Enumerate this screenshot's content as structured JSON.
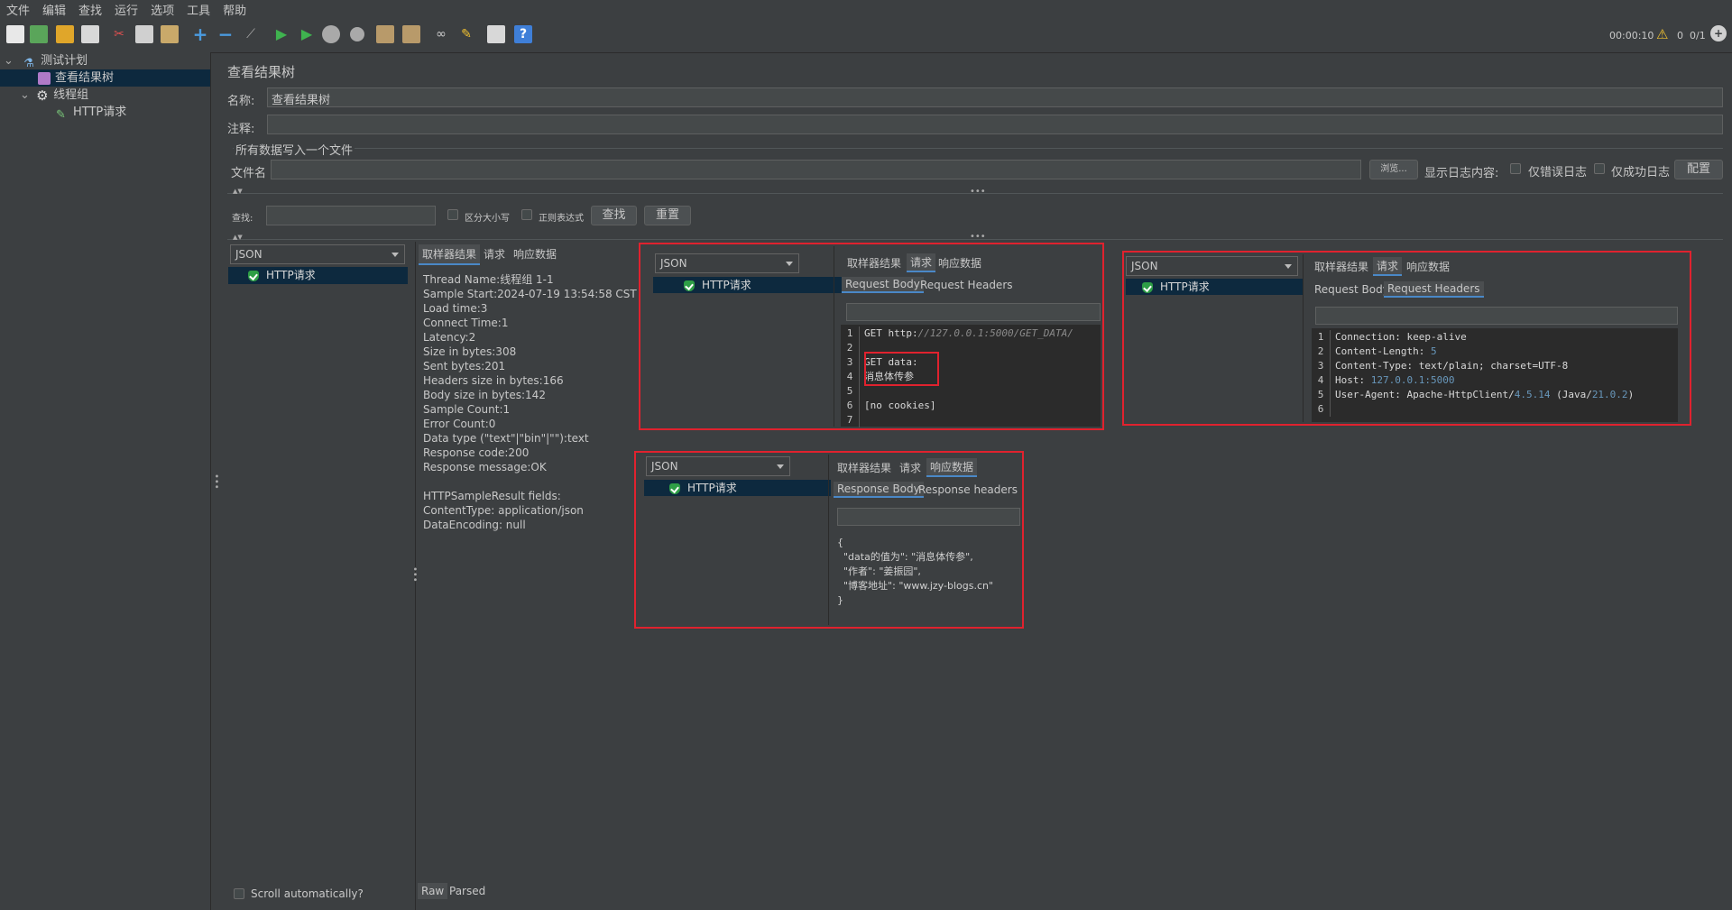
{
  "menu": [
    "文件",
    "编辑",
    "查找",
    "运行",
    "选项",
    "工具",
    "帮助"
  ],
  "toolbar": {
    "timer": "00:00:10",
    "warnings": "0",
    "threads": "0/1"
  },
  "tree": {
    "plan": "测试计划",
    "listener": "查看结果树",
    "group": "线程组",
    "sampler": "HTTP请求"
  },
  "main": {
    "title": "查看结果树",
    "name_label": "名称:",
    "name_value": "查看结果树",
    "comment_label": "注释:",
    "comment_value": "",
    "file_section": "所有数据写入一个文件",
    "filename_label": "文件名",
    "filename_value": "",
    "browse": "浏览...",
    "log_label": "显示日志内容:",
    "errors_only": "仅错误日志",
    "success_only": "仅成功日志",
    "configure": "配置",
    "search_label": "查找:",
    "case_sensitive": "区分大小写",
    "regex": "正则表达式",
    "search_btn": "查找",
    "reset_btn": "重置",
    "renderer": "JSON",
    "result_item": "HTTP请求",
    "scroll_auto": "Scroll automatically?",
    "tab_sampler": "取样器结果",
    "tab_request": "请求",
    "tab_response": "响应数据",
    "raw": "Raw",
    "parsed": "Parsed"
  },
  "sampler_result": [
    "Thread Name:线程组 1-1",
    "Sample Start:2024-07-19 13:54:58 CST",
    "Load time:3",
    "Connect Time:1",
    "Latency:2",
    "Size in bytes:308",
    "Sent bytes:201",
    "Headers size in bytes:166",
    "Body size in bytes:142",
    "Sample Count:1",
    "Error Count:0",
    "Data type (\"text\"|\"bin\"|\"\"):text",
    "Response code:200",
    "Response message:OK",
    "",
    "HTTPSampleResult fields:",
    "ContentType: application/json",
    "DataEncoding: null"
  ],
  "inset_request_body": {
    "combo": "JSON",
    "item": "HTTP请求",
    "tab_sampler": "取样器结果",
    "tab_request": "请求",
    "tab_response": "响应数据",
    "sub_body": "Request Body",
    "sub_headers": "Request Headers",
    "lines": [
      "GET http://127.0.0.1:5000/GET_DATA/",
      "",
      "GET data:",
      "消息体传参",
      "",
      "[no cookies]",
      ""
    ]
  },
  "inset_request_headers": {
    "combo": "JSON",
    "item": "HTTP请求",
    "tab_sampler": "取样器结果",
    "tab_request": "请求",
    "tab_response": "响应数据",
    "sub_body": "Request Body",
    "sub_headers": "Request Headers",
    "lines": [
      {
        "key": "Connection: ",
        "val": "keep-alive",
        "extra": ""
      },
      {
        "key": "Content-Length: ",
        "val": "5",
        "extra": ""
      },
      {
        "key": "Content-Type: ",
        "val": "text/plain; charset=UTF-8",
        "extra": ""
      },
      {
        "key": "Host: ",
        "val": "127.0.0.1",
        "extra": ":5000"
      },
      {
        "key": "User-Agent: ",
        "val": "Apache-HttpClient/",
        "extra": "4.5.14"
      },
      {
        "key": "",
        "val": "",
        "extra": ""
      }
    ],
    "ua_tail1": " (Java/",
    "ua_tail2": "21.0.2",
    "ua_tail3": ")"
  },
  "inset_response": {
    "combo": "JSON",
    "item": "HTTP请求",
    "tab_sampler": "取样器结果",
    "tab_request": "请求",
    "tab_response": "响应数据",
    "sub_body": "Response Body",
    "sub_headers": "Response headers",
    "lines": [
      "{",
      "  \"data的值为\": \"消息体传参\",",
      "  \"作者\": \"姜振园\",",
      "  \"博客地址\": \"www.jzy-blogs.cn\"",
      "}"
    ]
  },
  "colors": {
    "background": "#3c3f41",
    "selection": "#0d293e",
    "highlight_box": "#e0222e",
    "accent": "#4a88c7",
    "success": "#2e9e46"
  }
}
